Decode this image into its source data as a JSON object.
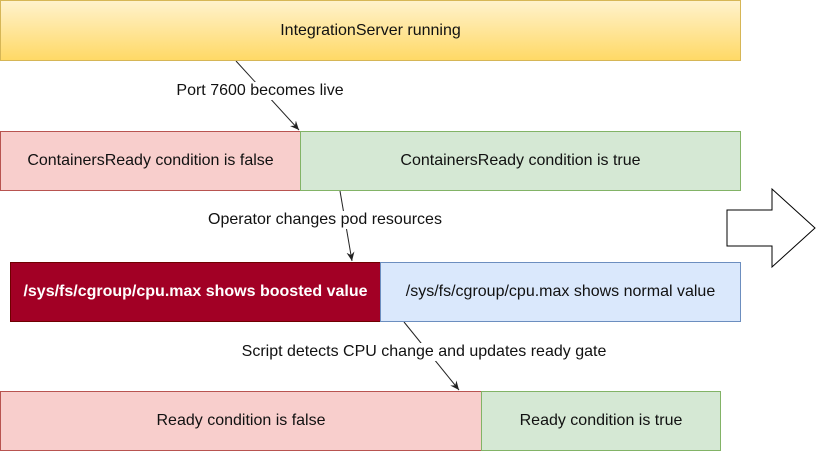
{
  "boxes": {
    "integration_server": "IntegrationServer running",
    "containers_false": "ContainersReady condition is false",
    "containers_true": "ContainersReady condition is true",
    "cpu_boosted": "/sys/fs/cgroup/cpu.max shows boosted value",
    "cpu_normal": "/sys/fs/cgroup/cpu.max shows normal value",
    "ready_false": "Ready condition is false",
    "ready_true": "Ready condition is true"
  },
  "edges": {
    "port_live": "Port 7600 becomes live",
    "operator_changes": "Operator changes pod resources",
    "script_detects": "Script detects CPU change and updates ready gate"
  },
  "colors": {
    "yellow": "#ffd966",
    "red": "#f8cecc",
    "green": "#d5e8d4",
    "dark_red": "#a20025",
    "blue": "#dae8fc"
  }
}
